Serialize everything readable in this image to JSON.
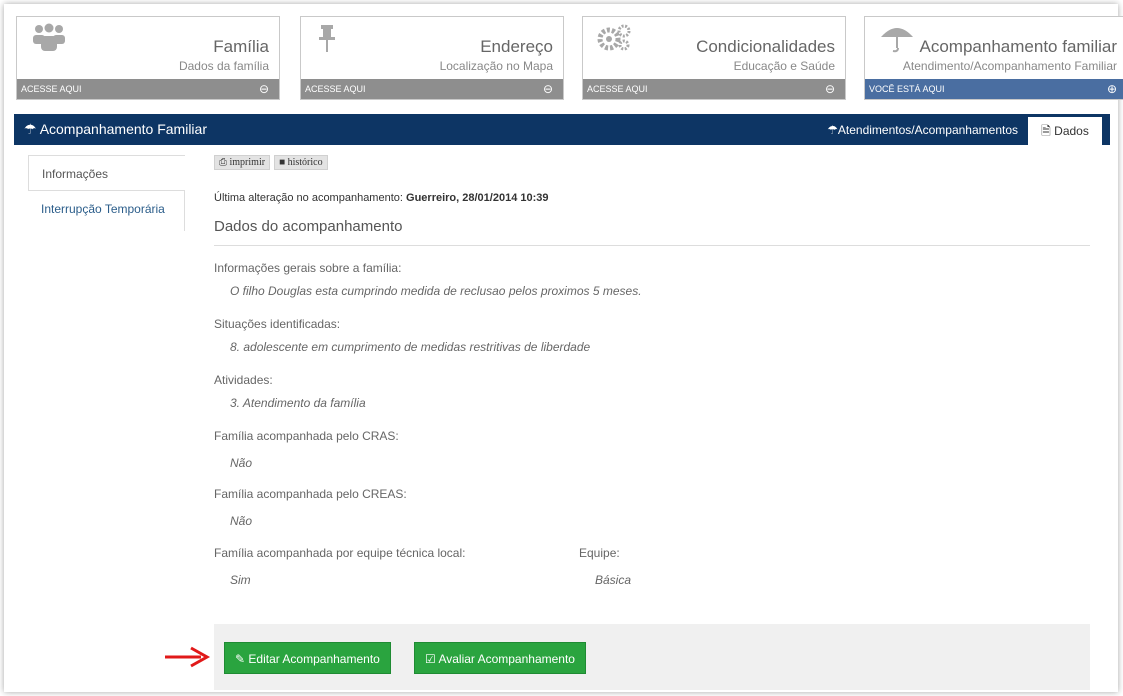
{
  "cards": [
    {
      "title": "Família",
      "sub": "Dados da família",
      "bar": "ACESSE AQUI",
      "arrow": "⊖",
      "icon": "people-icon"
    },
    {
      "title": "Endereço",
      "sub": "Localização no Mapa",
      "bar": "ACESSE AQUI",
      "arrow": "⊖",
      "icon": "pin-icon"
    },
    {
      "title": "Condicionalidades",
      "sub": "Educação e Saúde",
      "bar": "ACESSE AQUI",
      "arrow": "⊖",
      "icon": "gears-icon"
    },
    {
      "title": "Acompanhamento familiar",
      "sub": "Atendimento/Acompanhamento Familiar",
      "bar": "VOCÊ ESTÁ AQUI",
      "arrow": "⊕",
      "icon": "umbrella-icon"
    }
  ],
  "navbar": {
    "brand": "Acompanhamento Familiar",
    "tab_link": "Atendimentos/Acompanhamentos",
    "tab_active": "Dados"
  },
  "side_tabs": [
    "Informações",
    "Interrupção Temporária"
  ],
  "tools": {
    "print": "imprimir",
    "history": "histórico"
  },
  "last_change": {
    "label": "Última alteração no acompanhamento:",
    "value": "Guerreiro, 28/01/2014 10:39"
  },
  "section_title": "Dados do acompanhamento",
  "fields": {
    "info_label": "Informações gerais sobre a família:",
    "info_value": "O filho Douglas esta cumprindo medida de reclusao pelos proximos 5 meses.",
    "situ_label": "Situações identificadas:",
    "situ_value": "8. adolescente em cumprimento de medidas restritivas de liberdade",
    "ativ_label": "Atividades:",
    "ativ_value": "3. Atendimento da família",
    "cras_label": "Família acompanhada pelo CRAS:",
    "cras_value": "Não",
    "creas_label": "Família acompanhada pelo CREAS:",
    "creas_value": "Não",
    "local_label": "Família acompanhada por equipe técnica local:",
    "local_value": "Sim",
    "equipe_label": "Equipe:",
    "equipe_value": "Básica"
  },
  "buttons": {
    "edit": "Editar Acompanhamento",
    "evaluate": "Avaliar Acompanhamento"
  },
  "colors": {
    "navbar": "#0d3564",
    "active_bar": "#4a6ea1",
    "button": "#2aa43f",
    "arrow": "#e11919"
  }
}
